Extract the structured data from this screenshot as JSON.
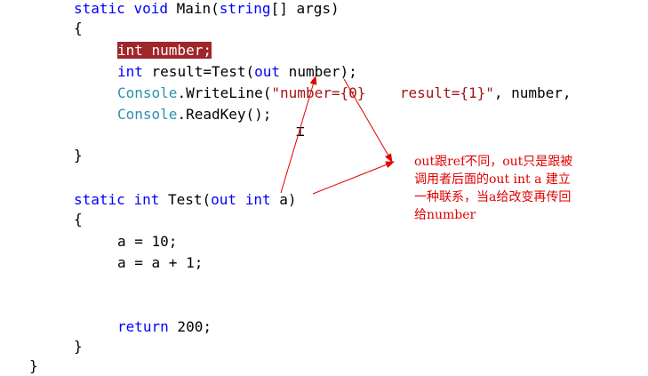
{
  "code": {
    "main_sig": {
      "kw1": "static",
      "kw2": "void",
      "name": " Main(",
      "type": "string",
      "rest": "[] args)"
    },
    "brace_open": "{",
    "decl_number": "int number;",
    "decl_result": {
      "type": "int",
      "mid": " result=Test(",
      "out": "out",
      "rest": " number);"
    },
    "writeline": {
      "cls": "Console",
      "method": ".WriteLine(",
      "str": "\"number={0}    result={1}\"",
      "rest": ", number,"
    },
    "readkey": {
      "cls": "Console",
      "rest": ".ReadKey();"
    },
    "brace_close": "}",
    "test_sig": {
      "kw1": "static",
      "kw2": "int",
      "name": " Test(",
      "out": "out",
      "kw3": "int",
      "rest": " a)"
    },
    "test_open": "{",
    "assign1": "a = 10;",
    "assign2": "a = a + 1;",
    "ret": {
      "kw": "return",
      "rest": " 200;"
    },
    "test_close": "}",
    "class_close": "}"
  },
  "annotation": "out跟ref不同，out只是跟被\n调用者后面的out int a 建立\n一种联系，当a给改变再传回\n给number",
  "colors": {
    "keyword": "#0000ff",
    "type": "#2b91af",
    "string": "#a31515",
    "highlight": "#a0262b",
    "annotation": "#e00000"
  }
}
